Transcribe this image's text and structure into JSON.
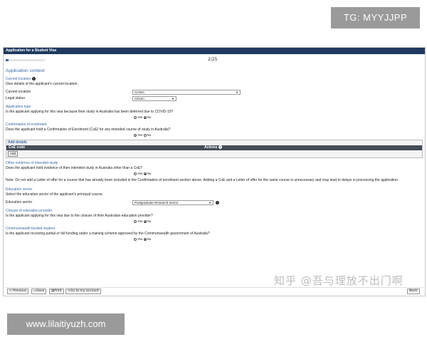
{
  "overlay": {
    "tg_label": "TG: MYYJJPP",
    "url_label": "www.lilaitiyuzh.com",
    "watermark": "知乎 @吾与理放不出门啊"
  },
  "window": {
    "title": "Application for a Student Visa",
    "page_counter": "2/25",
    "progress_fraction": 0.08
  },
  "context": {
    "section_title": "Application context",
    "current_location": {
      "heading": "Current location",
      "help": "Give details of the applicant's current location.",
      "location_label": "Current location",
      "location_value": "CHINA",
      "legal_status_label": "Legal status",
      "legal_status_value": "Citizen"
    },
    "application_type": {
      "heading": "Application type",
      "question": "Is the applicant applying for this visa because their study in Australia has been deferred due to COVID-19?",
      "yes": "Yes",
      "no": "No",
      "selected": "No"
    },
    "coe": {
      "heading": "Confirmation of enrolment",
      "question": "Does the applicant hold a Confirmation of Enrolment (CoE) for any intended course of study in Australia?",
      "yes": "Yes",
      "no": "No",
      "selected": "Yes",
      "add_details": "Add details",
      "col_code": "CoE code",
      "col_actions": "Actions",
      "add_button": "Add"
    },
    "other_evidence": {
      "heading": "Other evidence of intended study",
      "question": "Does the applicant hold evidence of their intended study in Australia other than a CoE?",
      "yes": "Yes",
      "no": "No",
      "selected": "No",
      "note": "Note: Do not add a Letter of offer for a course that has already been included in the Confirmation of enrolment section above. Adding a CoE and a Letter of offer for the same course is unnecessary and may lead to delays in processing the application."
    },
    "education_sector": {
      "heading": "Education sector",
      "help": "Select the education sector of the applicant's principal course.",
      "label": "Education sector",
      "value": "Postgraduate Research Sector"
    },
    "closure": {
      "heading": "Closure of education provider",
      "question": "Is the applicant applying for this visa due to the closure of their Australian education provider?",
      "yes": "Yes",
      "no": "No",
      "selected": "No"
    },
    "commonwealth": {
      "heading": "Commonwealth funded student",
      "question": "Is the applicant receiving partial or full funding under a training scheme approved by the Commonwealth government of Australia?",
      "yes": "Yes",
      "no": "No",
      "selected": "No"
    }
  },
  "footer": {
    "previous": "< Previous",
    "save": "Save",
    "print": "Print",
    "go_to_account": "Go to my account",
    "next": "Next"
  }
}
